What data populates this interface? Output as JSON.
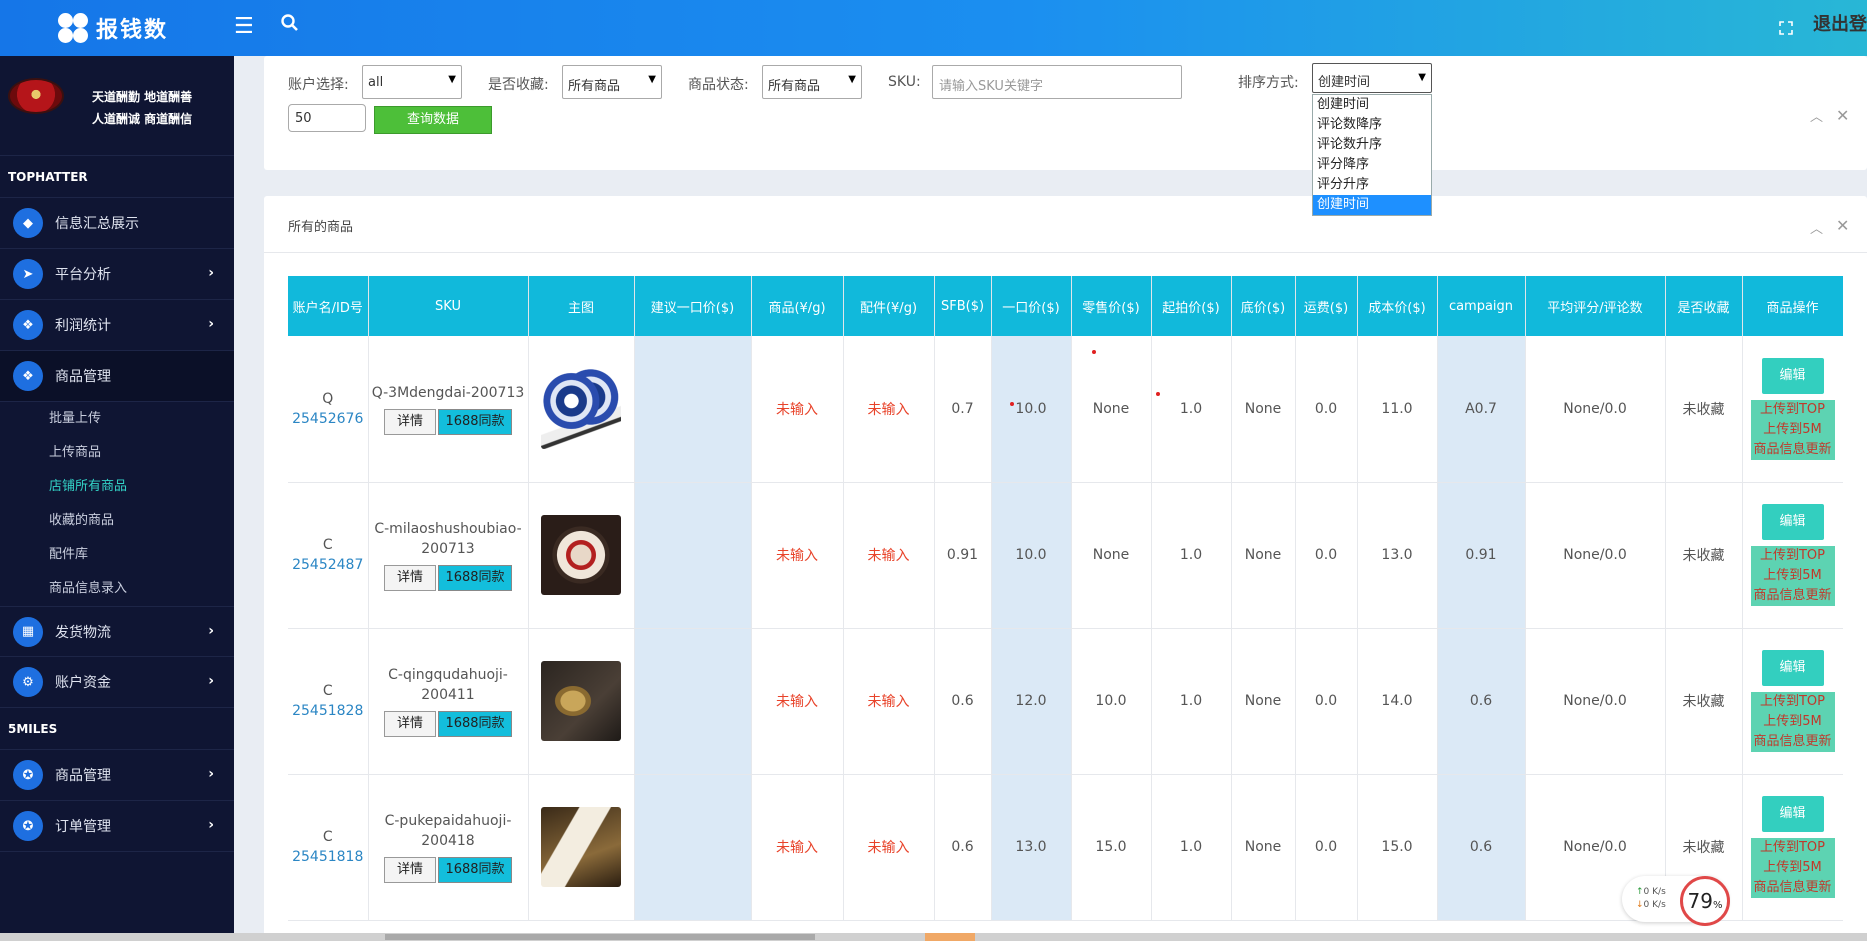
{
  "header": {
    "logo_text": "报钱数",
    "logout": "退出登"
  },
  "profile": {
    "motto_line1": "天道酬勤 地道酬善",
    "motto_line2": "人道酬诚 商道酬信"
  },
  "sidebar": {
    "section1": "TOPHATTER",
    "items": [
      {
        "label": "信息汇总展示",
        "icon": "diamond-icon"
      },
      {
        "label": "平台分析",
        "icon": "paper-plane-icon"
      },
      {
        "label": "利润统计",
        "icon": "cubes-icon"
      },
      {
        "label": "商品管理",
        "icon": "cubes-icon"
      }
    ],
    "subitems": [
      "批量上传",
      "上传商品",
      "店铺所有商品",
      "收藏的商品",
      "配件库",
      "商品信息录入"
    ],
    "items2": [
      {
        "label": "发货物流",
        "icon": "table-icon"
      },
      {
        "label": "账户资金",
        "icon": "gear-icon"
      }
    ],
    "section2": "5MILES",
    "items3": [
      {
        "label": "商品管理",
        "icon": "soccer-icon"
      },
      {
        "label": "订单管理",
        "icon": "soccer-icon"
      }
    ]
  },
  "filters": {
    "account_label": "账户选择:",
    "account_value": "all",
    "fav_label": "是否收藏:",
    "fav_value": "所有商品",
    "status_label": "商品状态:",
    "status_value": "所有商品",
    "sku_label": "SKU:",
    "sku_placeholder": "请输入SKU关键字",
    "sort_label": "排序方式:",
    "sort_value": "创建时间",
    "limit_value": "50",
    "query_button": "查询数据",
    "sort_options": [
      "创建时间",
      "评论数降序",
      "评论数升序",
      "评分降序",
      "评分升序",
      "创建时间"
    ]
  },
  "panel_title": "所有的商品",
  "table": {
    "headers": [
      "账户名/ID号",
      "SKU",
      "主图",
      "建议一口价($)",
      "商品(¥/g)",
      "配件(¥/g)",
      "SFB($)",
      "一口价($)",
      "零售价($)",
      "起拍价($)",
      "底价($)",
      "运费($)",
      "成本价($)",
      "campaign",
      "平均评分/评论数",
      "是否收藏",
      "商品操作"
    ],
    "detail_btn": "详情",
    "same_btn": "1688同款",
    "edit_btn": "编辑",
    "tag1": "上传到TOP",
    "tag2": "上传到5M",
    "tag3": "商品信息更新",
    "rows": [
      {
        "account": "Q",
        "id": "25452676",
        "sku": "Q-3Mdengdai-200713",
        "suggest": "",
        "goods": "未输入",
        "parts": "未输入",
        "sfb": "0.7",
        "fixed": "10.0",
        "retail": "None",
        "start": "1.0",
        "floor": "None",
        "ship": "0.0",
        "cost": "11.0",
        "campaign": "A0.7",
        "rating": "None/0.0",
        "fav": "未收藏"
      },
      {
        "account": "C",
        "id": "25452487",
        "sku": "C-milaoshushoubiao-200713",
        "suggest": "",
        "goods": "未输入",
        "parts": "未输入",
        "sfb": "0.91",
        "fixed": "10.0",
        "retail": "None",
        "start": "1.0",
        "floor": "None",
        "ship": "0.0",
        "cost": "13.0",
        "campaign": "0.91",
        "rating": "None/0.0",
        "fav": "未收藏"
      },
      {
        "account": "C",
        "id": "25451828",
        "sku": "C-qingqudahuoji-200411",
        "suggest": "",
        "goods": "未输入",
        "parts": "未输入",
        "sfb": "0.6",
        "fixed": "12.0",
        "retail": "10.0",
        "start": "1.0",
        "floor": "None",
        "ship": "0.0",
        "cost": "14.0",
        "campaign": "0.6",
        "rating": "None/0.0",
        "fav": "未收藏"
      },
      {
        "account": "C",
        "id": "25451818",
        "sku": "C-pukepaidahuoji-200418",
        "suggest": "",
        "goods": "未输入",
        "parts": "未输入",
        "sfb": "0.6",
        "fixed": "13.0",
        "retail": "15.0",
        "start": "1.0",
        "floor": "None",
        "ship": "0.0",
        "cost": "15.0",
        "campaign": "0.6",
        "rating": "None/0.0",
        "fav": "未收藏"
      }
    ]
  },
  "widget": {
    "up": "0",
    "down": "0",
    "unit": "K/s",
    "percent": "79",
    "percent_sign": "%"
  },
  "colors": {
    "topbar": "#1b8ff0",
    "sidebar": "#0f1533",
    "table_header": "#11b9db",
    "accent_teal": "#33cfbf",
    "query_green": "#4dbf39"
  }
}
